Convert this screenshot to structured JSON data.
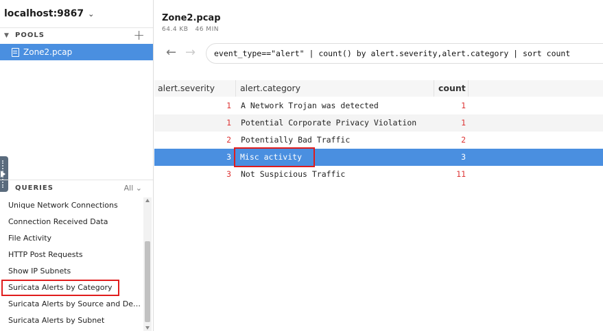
{
  "sidebar": {
    "host": "localhost:9867",
    "pools_label": "POOLS",
    "pools": [
      {
        "label": "Zone2.pcap",
        "selected": true
      }
    ],
    "queries_label": "QUERIES",
    "queries_filter": "All",
    "queries": [
      {
        "label": "Unique Network Connections"
      },
      {
        "label": "Connection Received Data"
      },
      {
        "label": "File Activity"
      },
      {
        "label": "HTTP Post Requests"
      },
      {
        "label": "Show IP Subnets"
      },
      {
        "label": "Suricata Alerts by Category",
        "highlighted": true
      },
      {
        "label": "Suricata Alerts by Source and Destination"
      },
      {
        "label": "Suricata Alerts by Subnet"
      }
    ]
  },
  "main": {
    "file_title": "Zone2.pcap",
    "file_size": "64.4 KB",
    "file_duration": "46 MIN",
    "query": "event_type==\"alert\" | count() by alert.severity,alert.category | sort count",
    "columns": [
      "alert.severity",
      "alert.category",
      "count"
    ],
    "rows": [
      {
        "severity": "1",
        "category": "A Network Trojan was detected",
        "count": "1"
      },
      {
        "severity": "1",
        "category": "Potential Corporate Privacy Violation",
        "count": "1"
      },
      {
        "severity": "2",
        "category": "Potentially Bad Traffic",
        "count": "2"
      },
      {
        "severity": "3",
        "category": "Misc activity",
        "count": "3",
        "selected": true
      },
      {
        "severity": "3",
        "category": "Not Suspicious Traffic",
        "count": "11"
      }
    ]
  },
  "colors": {
    "accent": "#4a8fe0",
    "number": "#dd3333",
    "highlight_box": "#e01b1b"
  }
}
